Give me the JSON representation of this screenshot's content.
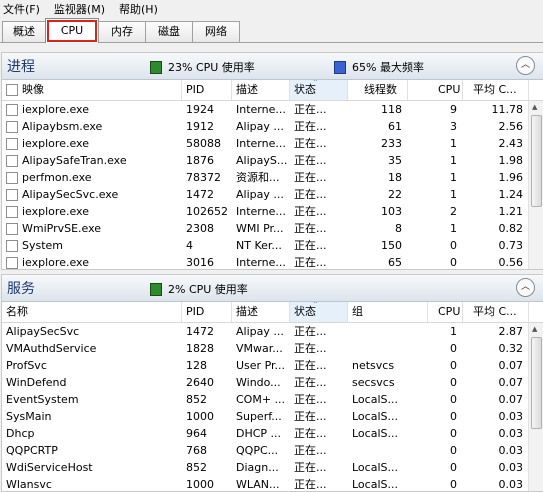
{
  "menu": [
    "文件(F)",
    "监视器(M)",
    "帮助(H)"
  ],
  "tabs": [
    "概述",
    "CPU",
    "内存",
    "磁盘",
    "网络"
  ],
  "process": {
    "title": "进程",
    "cpu_usage": "23% CPU 使用率",
    "max_freq": "65% 最大频率",
    "columns": [
      "映像",
      "PID",
      "描述",
      "状态",
      "线程数",
      "CPU",
      "平均 C..."
    ],
    "rows": [
      [
        "iexplore.exe",
        "1924",
        "Interne...",
        "正在...",
        "118",
        "9",
        "11.78"
      ],
      [
        "Alipaybsm.exe",
        "1912",
        "Alipay ...",
        "正在...",
        "61",
        "3",
        "2.56"
      ],
      [
        "iexplore.exe",
        "58088",
        "Interne...",
        "正在...",
        "233",
        "1",
        "2.43"
      ],
      [
        "AlipaySafeTran.exe",
        "1876",
        "AlipayS...",
        "正在...",
        "35",
        "1",
        "1.98"
      ],
      [
        "perfmon.exe",
        "78372",
        "资源和...",
        "正在...",
        "18",
        "1",
        "1.96"
      ],
      [
        "AlipaySecSvc.exe",
        "1472",
        "Alipay ...",
        "正在...",
        "22",
        "1",
        "1.24"
      ],
      [
        "iexplore.exe",
        "102652",
        "Interne...",
        "正在...",
        "103",
        "2",
        "1.21"
      ],
      [
        "WmiPrvSE.exe",
        "2308",
        "WMI Pr...",
        "正在...",
        "8",
        "1",
        "0.82"
      ],
      [
        "System",
        "4",
        "NT Ker...",
        "正在...",
        "150",
        "0",
        "0.73"
      ],
      [
        "iexplore.exe",
        "3016",
        "Interne...",
        "正在...",
        "65",
        "0",
        "0.56"
      ]
    ]
  },
  "services": {
    "title": "服务",
    "cpu_usage": "2% CPU 使用率",
    "columns": [
      "名称",
      "PID",
      "描述",
      "状态",
      "组",
      "CPU",
      "平均 C..."
    ],
    "rows": [
      [
        "AlipaySecSvc",
        "1472",
        "Alipay ...",
        "正在...",
        "",
        "1",
        "2.87"
      ],
      [
        "VMAuthdService",
        "1828",
        "VMwar...",
        "正在...",
        "",
        "0",
        "0.32"
      ],
      [
        "ProfSvc",
        "128",
        "User Pr...",
        "正在...",
        "netsvcs",
        "0",
        "0.07"
      ],
      [
        "WinDefend",
        "2640",
        "Windo...",
        "正在...",
        "secsvcs",
        "0",
        "0.07"
      ],
      [
        "EventSystem",
        "852",
        "COM+ ...",
        "正在...",
        "LocalS...",
        "0",
        "0.07"
      ],
      [
        "SysMain",
        "1000",
        "Superf...",
        "正在...",
        "LocalS...",
        "0",
        "0.03"
      ],
      [
        "Dhcp",
        "964",
        "DHCP ...",
        "正在...",
        "LocalS...",
        "0",
        "0.03"
      ],
      [
        "QQPCRTP",
        "768",
        "QQPC...",
        "正在...",
        "",
        "0",
        "0.03"
      ],
      [
        "WdiServiceHost",
        "852",
        "Diagn...",
        "正在...",
        "LocalS...",
        "0",
        "0.03"
      ],
      [
        "Wlansvc",
        "1000",
        "WLAN...",
        "正在...",
        "LocalS...",
        "0",
        "0.03"
      ]
    ]
  }
}
